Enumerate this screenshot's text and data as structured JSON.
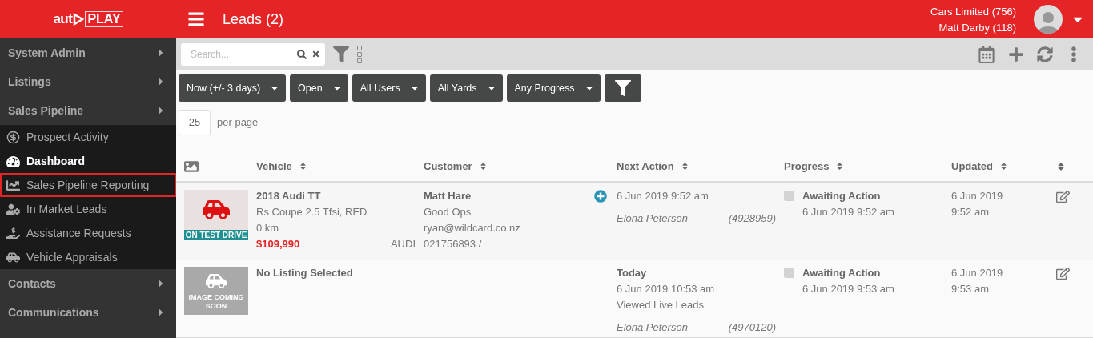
{
  "header": {
    "logo": [
      "aut",
      "PLAY"
    ],
    "title": "Leads (2)",
    "account": "Cars Limited (756)",
    "user": "Matt Darby (118)"
  },
  "sidebar": {
    "items": [
      {
        "label": "System Admin",
        "kind": "section"
      },
      {
        "label": "Listings",
        "kind": "section"
      },
      {
        "label": "Sales Pipeline",
        "kind": "section",
        "children": [
          {
            "label": "Prospect Activity",
            "selected": false,
            "outlined": false
          },
          {
            "label": "Dashboard",
            "selected": true,
            "outlined": false
          },
          {
            "label": "Sales Pipeline Reporting",
            "selected": false,
            "outlined": true
          },
          {
            "label": "In Market Leads",
            "selected": false,
            "outlined": false
          },
          {
            "label": "Assistance Requests",
            "selected": false,
            "outlined": false
          },
          {
            "label": "Vehicle Appraisals",
            "selected": false,
            "outlined": false
          }
        ]
      },
      {
        "label": "Contacts",
        "kind": "section"
      },
      {
        "label": "Communications",
        "kind": "section"
      }
    ]
  },
  "toolbar": {
    "search": {
      "placeholder": "Search..."
    }
  },
  "filters": [
    {
      "label": "Now (+/- 3 days)"
    },
    {
      "label": "Open"
    },
    {
      "label": "All Users"
    },
    {
      "label": "All Yards"
    },
    {
      "label": "Any Progress"
    }
  ],
  "per_page": {
    "value": "25",
    "label": "per page"
  },
  "table": {
    "columns": [
      {
        "kind": "image"
      },
      {
        "kind": "text",
        "label": "Vehicle"
      },
      {
        "kind": "text",
        "label": "Customer"
      },
      {
        "kind": "text",
        "label": "Next Action"
      },
      {
        "kind": "text",
        "label": "Progress"
      },
      {
        "kind": "text",
        "label": "Updated"
      },
      {
        "kind": "sort"
      }
    ],
    "rows": [
      {
        "vehicle": {
          "badge": "ON TEST DRIVE",
          "title": "2018 Audi TT",
          "lines": [
            "Rs Coupe 2.5 Tfsi, RED",
            "0 km"
          ],
          "price": "$109,990",
          "make": "AUDI"
        },
        "customer": {
          "name": "Matt Hare",
          "lines": [
            "Good Ops",
            "ryan@wildcard.co.nz",
            "021756893 /"
          ]
        },
        "next_action": {
          "lines": [
            "6 Jun 2019 9:52 am"
          ],
          "agent": "Elona Peterson",
          "ref": "(4928959)"
        },
        "progress": {
          "checked": false,
          "status": "Awaiting Action",
          "date": "6 Jun 2019 9:52 am"
        },
        "updated": [
          "6 Jun 2019",
          "9:52 am"
        ]
      },
      {
        "vehicle": {
          "placeholder_text": "IMAGE COMING SOON",
          "title": "No Listing Selected"
        },
        "next_action": {
          "heading": "Today",
          "lines": [
            "6 Jun 2019 10:53 am",
            "Viewed Live Leads"
          ],
          "agent": "Elona Peterson",
          "ref": "(4970120)"
        },
        "progress": {
          "checked": false,
          "status": "Awaiting Action",
          "date": "6 Jun 2019 9:53 am"
        },
        "updated": [
          "6 Jun 2019",
          "9:53 am"
        ]
      }
    ]
  }
}
